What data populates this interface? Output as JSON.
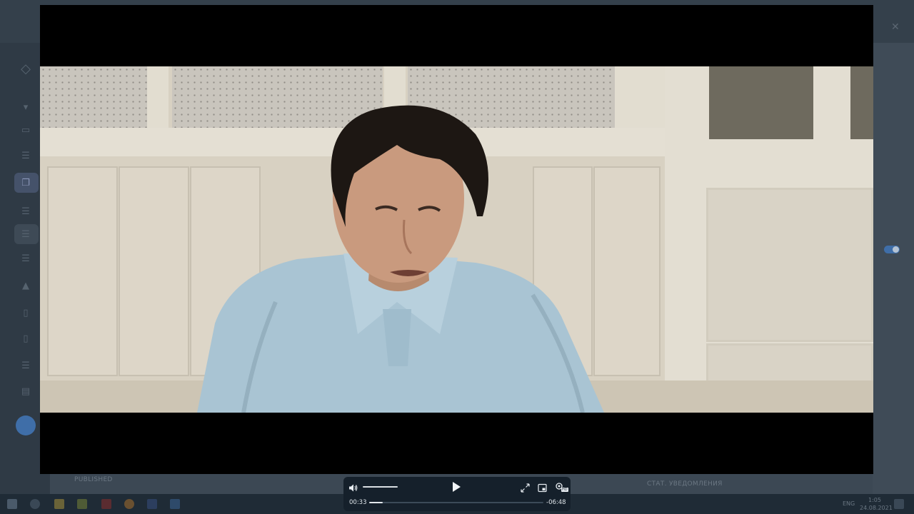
{
  "background_app": {
    "labels": {
      "published": "PUBLISHED",
      "status_footer": "СТАТ. УВЕДОМЛЕНИЯ"
    }
  },
  "taskbar": {
    "lang": "ENG",
    "time": "1:05",
    "date": "24.08.2021"
  },
  "player": {
    "current_time": "00:33",
    "remaining_time": "-06:48",
    "progress_fraction": 0.076,
    "volume_fraction": 1.0,
    "state": "paused",
    "quality_badge": "HD"
  },
  "colors": {
    "accent": "#3f6ea8",
    "controls_bg": "#15202b"
  }
}
